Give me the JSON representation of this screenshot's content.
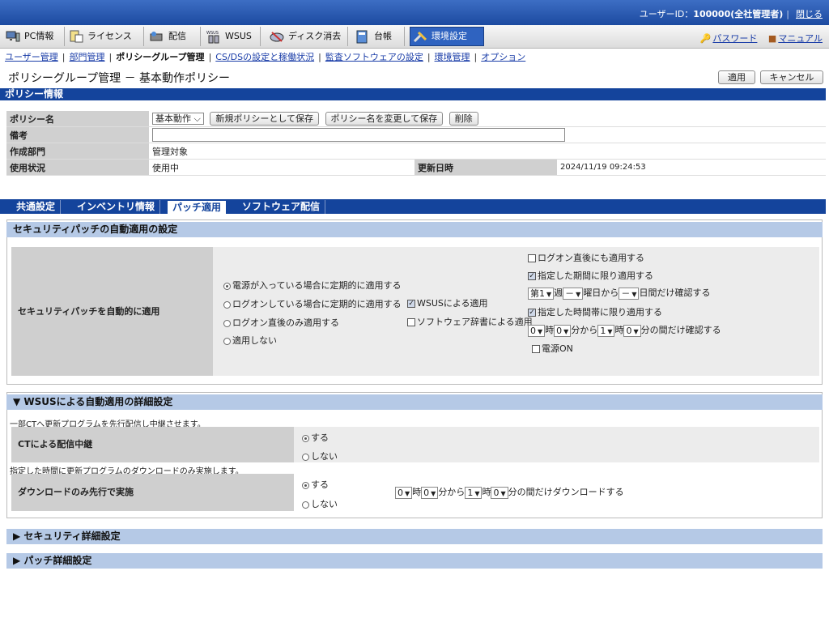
{
  "topbar": {
    "uid_label": "ユーザーID：",
    "uid_value": "100000(全社管理者)",
    "close": "閉じる"
  },
  "mainmenu": {
    "items": [
      "PC情報",
      "ライセンス",
      "配信",
      "WSUS",
      "ディスク消去",
      "台帳",
      "環境設定"
    ],
    "password": "パスワード",
    "manual": "マニュアル"
  },
  "submenu": {
    "items": [
      "ユーザー管理",
      "部門管理",
      "ポリシーグループ管理",
      "CS/DSの設定と稼働状況",
      "監査ソフトウェアの設定",
      "環境管理",
      "オプション"
    ]
  },
  "page": {
    "title": "ポリシーグループ管理 － 基本動作ポリシー",
    "apply": "適用",
    "cancel": "キャンセル"
  },
  "policy_info": {
    "header": "ポリシー情報",
    "name_label": "ポリシー名",
    "name_value": "基本動作",
    "save_new": "新規ポリシーとして保存",
    "save_rename": "ポリシー名を変更して保存",
    "delete": "削除",
    "note_label": "備考",
    "dept_label": "作成部門",
    "dept_value": "管理対象",
    "status_label": "使用状況",
    "status_value": "使用中",
    "updated_label": "更新日時",
    "updated_value": "2024/11/19 09:24:53"
  },
  "tabs": [
    "共通設定",
    "インベントリ情報",
    "パッチ適用",
    "ソフトウェア配信"
  ],
  "auto_patch": {
    "header": "セキュリティパッチの自動適用の設定",
    "row_label": "セキュリティパッチを自動的に適用",
    "radios": [
      "電源が入っている場合に定期的に適用する",
      "ログオンしている場合に定期的に適用する",
      "ログオン直後のみ適用する",
      "適用しない"
    ],
    "wsus": "WSUSによる適用",
    "dict": "ソフトウェア辞書による適用",
    "logon_after": "ログオン直後にも適用する",
    "period_only": "指定した期間に限り適用する",
    "week_sel": "第1",
    "week_suffix": "週",
    "day_sel": "－",
    "day_suffix": "曜日から",
    "days_sel": "－",
    "days_suffix": "日間だけ確認する",
    "time_only": "指定した時間帯に限り適用する",
    "h1": "0",
    "ji": "時",
    "m1": "0",
    "fun_from": "分から",
    "h2": "1",
    "m2": "0",
    "fun_check": "分の間だけ確認する",
    "power_on": "電源ON"
  },
  "wsus_detail": {
    "header": "▼ WSUSによる自動適用の詳細設定",
    "note1": "一部CTへ更新プログラムを先行配信し中継させます。",
    "relay_label": "CTによる配信中継",
    "yes": "する",
    "no": "しない",
    "note2": "指定した時間に更新プログラムのダウンロードのみ実施します。",
    "dl_label": "ダウンロードのみ先行で実施",
    "h1": "0",
    "ji": "時",
    "m1": "0",
    "fun_from": "分から",
    "h2": "1",
    "m2": "0",
    "fun_dl": "分の間だけダウンロードする"
  },
  "collapsed": [
    "▶ セキュリティ詳細設定",
    "▶ パッチ詳細設定"
  ]
}
